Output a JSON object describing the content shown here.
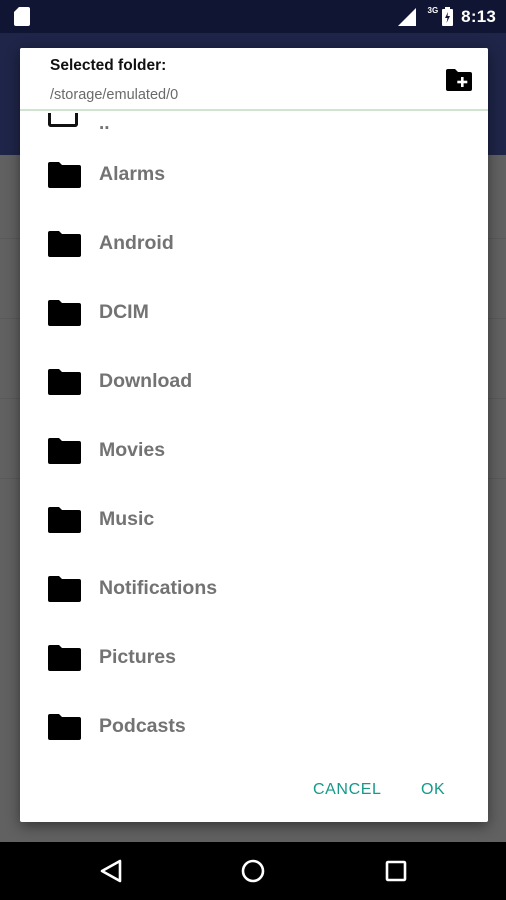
{
  "status_bar": {
    "network_label": "3G",
    "time": "8:13",
    "icons": [
      "sd-card-icon",
      "signal-icon",
      "battery-charging-icon"
    ]
  },
  "dialog": {
    "title": "Selected folder:",
    "path": "/storage/emulated/0",
    "new_folder_icon": "create-new-folder-icon",
    "parent_label": "..",
    "folders": [
      {
        "label": "Alarms"
      },
      {
        "label": "Android"
      },
      {
        "label": "DCIM"
      },
      {
        "label": "Download"
      },
      {
        "label": "Movies"
      },
      {
        "label": "Music"
      },
      {
        "label": "Notifications"
      },
      {
        "label": "Pictures"
      },
      {
        "label": "Podcasts"
      }
    ],
    "cancel_label": "CANCEL",
    "ok_label": "OK",
    "accent_color": "#159a8a"
  },
  "nav_bar": {
    "icons": [
      "back-icon",
      "home-icon",
      "recents-icon"
    ]
  }
}
